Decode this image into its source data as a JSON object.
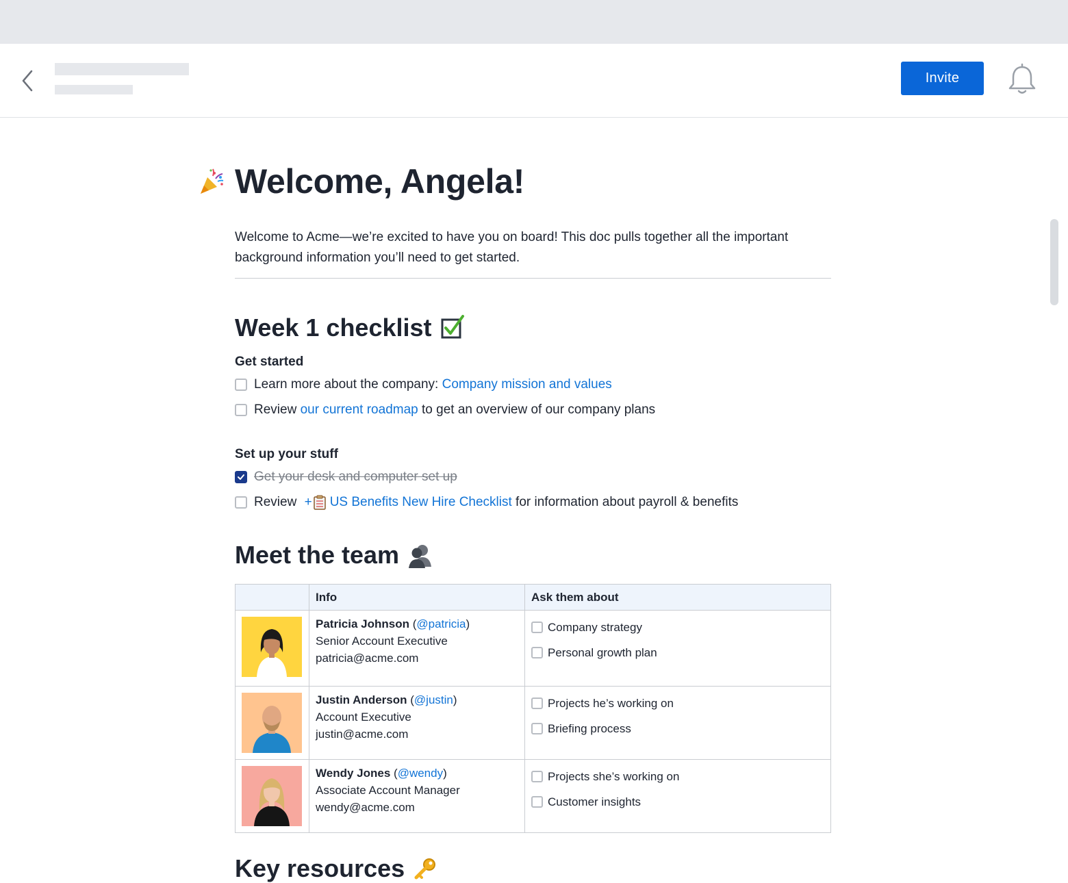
{
  "header": {
    "invite_label": "Invite"
  },
  "doc": {
    "title": "Welcome, Angela!",
    "intro": "Welcome to Acme—we’re excited to have you on board! This doc pulls together all the important background information you’ll need to get started.",
    "week1": {
      "heading": "Week 1 checklist",
      "get_started": {
        "heading": "Get started",
        "item1_text": "Learn more about the company: ",
        "item1_link": "Company mission and values",
        "item2_pre": "Review ",
        "item2_link": "our current roadmap",
        "item2_post": " to get an overview of our company plans"
      },
      "setup": {
        "heading": "Set up your stuff",
        "item1_text": "Get your desk and computer set up",
        "item2_pre": "Review ",
        "item2_plus": "+",
        "item2_link": "US Benefits New Hire Checklist",
        "item2_post": " for information about payroll & benefits"
      }
    },
    "team": {
      "heading": "Meet the team",
      "columns": [
        "",
        "Info",
        "Ask them about"
      ],
      "members": [
        {
          "name": "Patricia Johnson",
          "handle": "@patricia",
          "role": "Senior Account Executive",
          "email": "patricia@acme.com",
          "bg": "#ffd53f",
          "ask": [
            "Company strategy",
            "Personal growth plan"
          ]
        },
        {
          "name": "Justin Anderson",
          "handle": "@justin",
          "role": "Account Executive",
          "email": "justin@acme.com",
          "bg": "#ffc48f",
          "ask": [
            "Projects he’s working on",
            "Briefing process"
          ]
        },
        {
          "name": "Wendy Jones",
          "handle": "@wendy",
          "role": "Associate Account Manager",
          "email": "wendy@acme.com",
          "bg": "#f7a89e",
          "ask": [
            "Projects she’s working on",
            "Customer insights"
          ]
        }
      ]
    },
    "resources": {
      "heading": "Key resources"
    }
  },
  "colors": {
    "accent": "#0a66d8",
    "link": "#1274d6",
    "checked": "#1a3a8c"
  },
  "icons": [
    "back-icon",
    "bell-icon",
    "party-popper-icon",
    "check-box-icon",
    "people-icon",
    "clipboard-icon",
    "key-icon"
  ]
}
